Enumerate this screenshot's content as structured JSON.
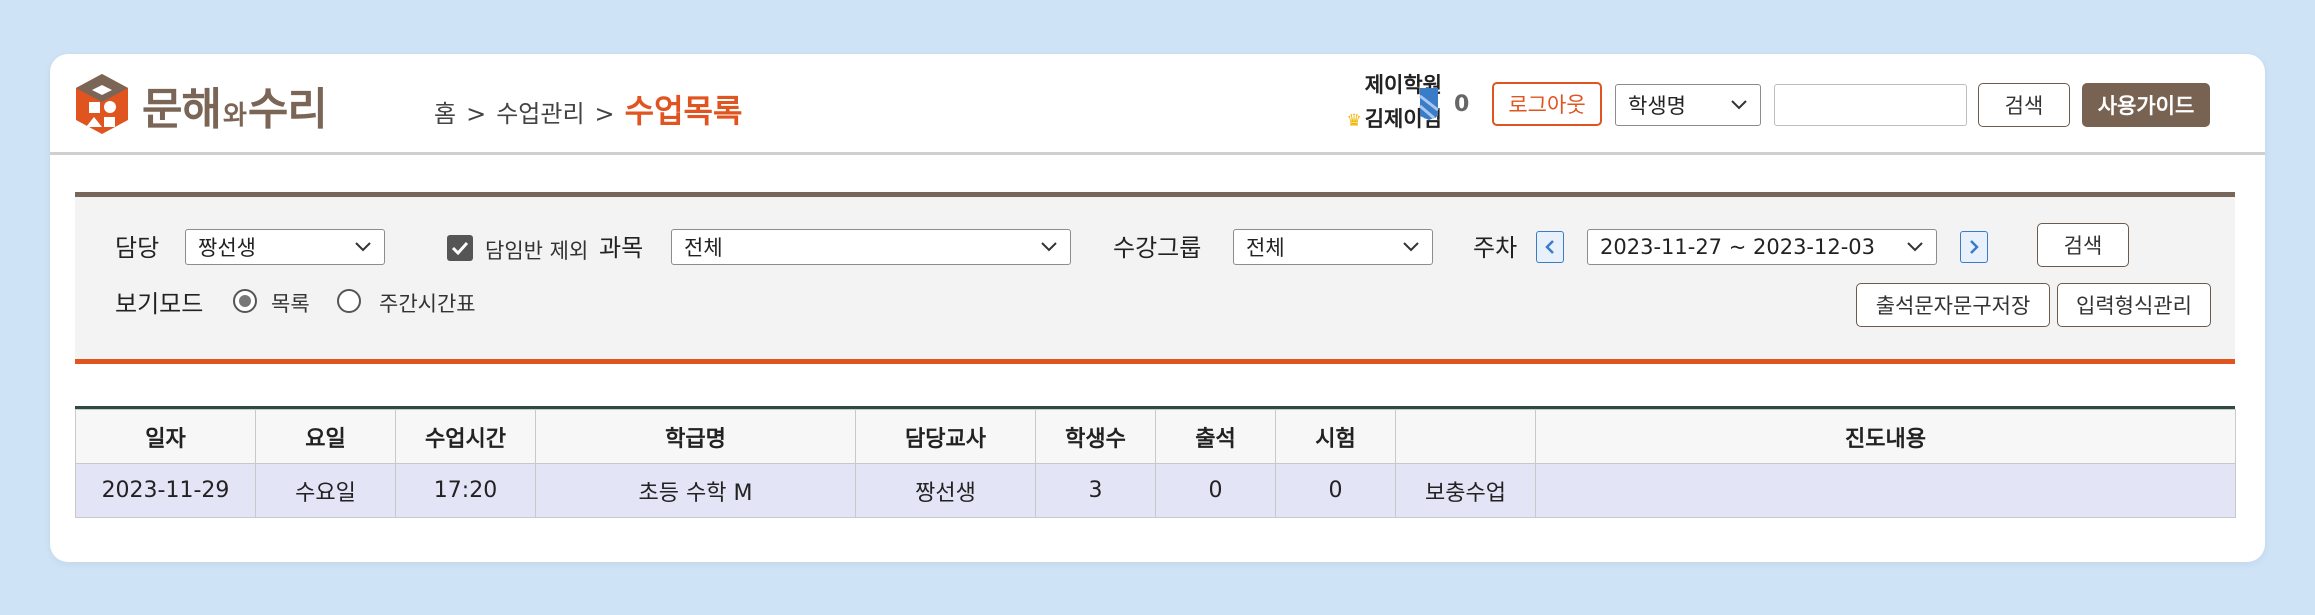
{
  "header": {
    "logo": {
      "part1": "문해",
      "part2": "와",
      "part3": "수리"
    },
    "breadcrumb": {
      "home": "홈",
      "sep": ">",
      "menu": "수업관리",
      "current": "수업목록"
    },
    "user": {
      "academy": "제이학원",
      "name": "김제이님"
    },
    "ticket_count": "0",
    "logout_label": "로그아웃",
    "search_select": {
      "selected": "학생명"
    },
    "search_input": {
      "value": "",
      "placeholder": ""
    },
    "search_label": "검색",
    "guide_label": "사용가이드"
  },
  "filter": {
    "teacher_label": "담당",
    "teacher_value": "짱선생",
    "exclude_homeroom_label": "담임반 제외",
    "exclude_homeroom_checked": true,
    "subject_label": "과목",
    "subject_value": "전체",
    "group_label": "수강그룹",
    "group_value": "전체",
    "week_label": "주차",
    "week_value": "2023-11-27 ~ 2023-12-03",
    "search_label": "검색",
    "view_mode_label": "보기모드",
    "view_options": [
      "목록",
      "주간시간표"
    ],
    "view_selected": "목록",
    "save_attendance_msg_label": "출석문자문구저장",
    "input_format_label": "입력형식관리"
  },
  "table": {
    "columns": [
      "일자",
      "요일",
      "수업시간",
      "학급명",
      "담당교사",
      "학생수",
      "출석",
      "시험",
      "",
      "진도내용"
    ],
    "rows": [
      [
        "2023-11-29",
        "수요일",
        "17:20",
        "초등 수학 M",
        "짱선생",
        "3",
        "0",
        "0",
        "보충수업",
        ""
      ]
    ]
  },
  "colors": {
    "accent": "#e0541f",
    "brand": "#786353",
    "background": "#cfe3f7",
    "row_highlight": "#e4e4f7"
  }
}
